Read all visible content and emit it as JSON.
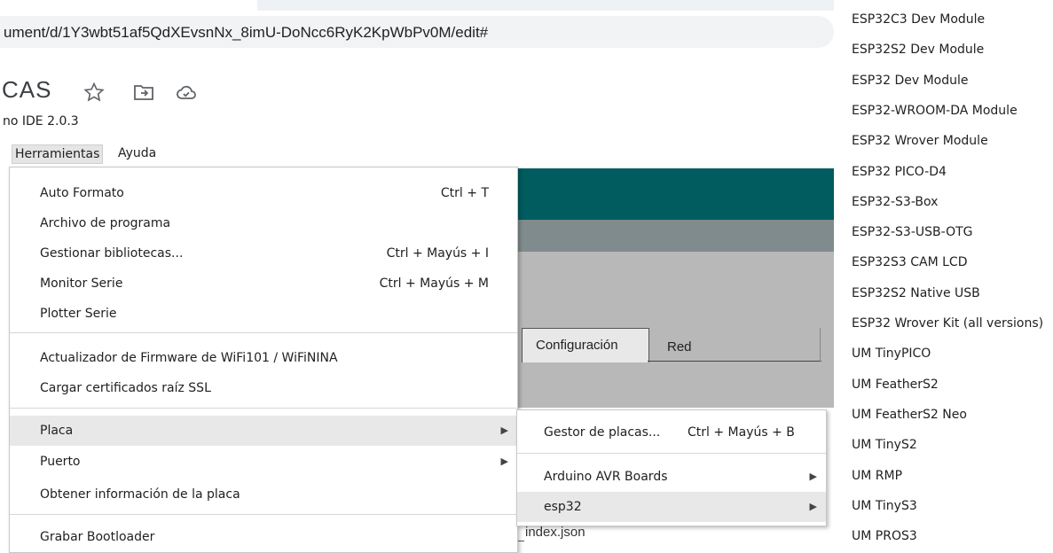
{
  "browser": {
    "url": "ument/d/1Y3wbt51af5QdXEvsnNx_8imU-DoNcc6RyK2KpWbPv0M/edit#",
    "doc_title": "CAS"
  },
  "ide": {
    "title": "no IDE 2.0.3",
    "menubar": {
      "herramientas": "Herramientas",
      "ayuda": "Ayuda"
    },
    "tabs": {
      "config": "Configuración",
      "red": "Red"
    },
    "index_json": "index.json"
  },
  "tools_menu": {
    "auto_formato": "Auto Formato",
    "auto_formato_sc": "Ctrl + T",
    "archivo": "Archivo de programa",
    "gestionar": "Gestionar bibliotecas...",
    "gestionar_sc": "Ctrl + Mayús + I",
    "monitor": "Monitor Serie",
    "monitor_sc": "Ctrl + Mayús + M",
    "plotter": "Plotter Serie",
    "actualizador": "Actualizador de Firmware de WiFi101 / WiFiNINA",
    "certificados": "Cargar certificados raíz SSL",
    "placa": "Placa",
    "puerto": "Puerto",
    "info_placa": "Obtener información de la placa",
    "bootloader": "Grabar Bootloader"
  },
  "placa_submenu": {
    "gestor": "Gestor de placas...",
    "gestor_sc": "Ctrl + Mayús + B",
    "avr": "Arduino AVR Boards",
    "esp32": "esp32"
  },
  "boards": [
    "ESP32C3 Dev Module",
    "ESP32S2 Dev Module",
    "ESP32 Dev Module",
    "ESP32-WROOM-DA Module",
    "ESP32 Wrover Module",
    "ESP32 PICO-D4",
    "ESP32-S3-Box",
    "ESP32-S3-USB-OTG",
    "ESP32S3 CAM LCD",
    "ESP32S2 Native USB",
    "ESP32 Wrover Kit (all versions)",
    "UM TinyPICO",
    "UM FeatherS2",
    "UM FeatherS2 Neo",
    "UM TinyS2",
    "UM RMP",
    "UM TinyS3",
    "UM PROS3"
  ]
}
